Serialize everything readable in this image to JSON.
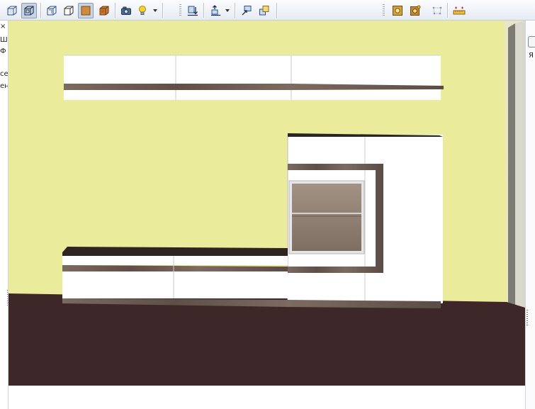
{
  "toolbar": {
    "groups": [
      {
        "name": "view-mode",
        "buttons": [
          {
            "icon": "wireframe-cube-icon",
            "active": false
          },
          {
            "icon": "hidden-line-cube-icon",
            "active": true
          },
          {
            "icon": "front-view-cube-icon",
            "active": false
          },
          {
            "icon": "outline-cube-icon",
            "active": false
          },
          {
            "icon": "solid-shaded-cube-icon",
            "active": true
          },
          {
            "icon": "textured-cube-icon",
            "active": false
          },
          {
            "icon": "camera-icon",
            "active": false
          },
          {
            "icon": "light-bulb-icon",
            "active": false,
            "has_dropdown": true
          }
        ]
      },
      {
        "name": "placement",
        "buttons": [
          {
            "icon": "place-on-floor-icon",
            "active": false
          },
          {
            "icon": "lift-object-icon",
            "active": false,
            "has_dropdown": true
          },
          {
            "icon": "move-to-wall-icon",
            "active": false
          },
          {
            "icon": "align-objects-icon",
            "active": false
          }
        ]
      },
      {
        "name": "render",
        "buttons": [
          {
            "icon": "render-image-icon",
            "active": false
          },
          {
            "icon": "render-settings-icon",
            "active": false
          },
          {
            "icon": "dimensions-points-icon",
            "active": false
          },
          {
            "icon": "measure-ruler-icon",
            "active": false
          }
        ]
      }
    ]
  },
  "left_panel": {
    "close_glyph": "×",
    "fragments": [
      "Ш",
      "Ф",
      "се",
      "ен"
    ]
  },
  "right_panel": {
    "fragment": "Я"
  },
  "scene": {
    "wall_color": "#ebeb9c",
    "floor_color": "#3e2728",
    "cabinet_white": "#ffffff",
    "wood_trim": "#6f6158",
    "glass_color": "#8f8074"
  }
}
